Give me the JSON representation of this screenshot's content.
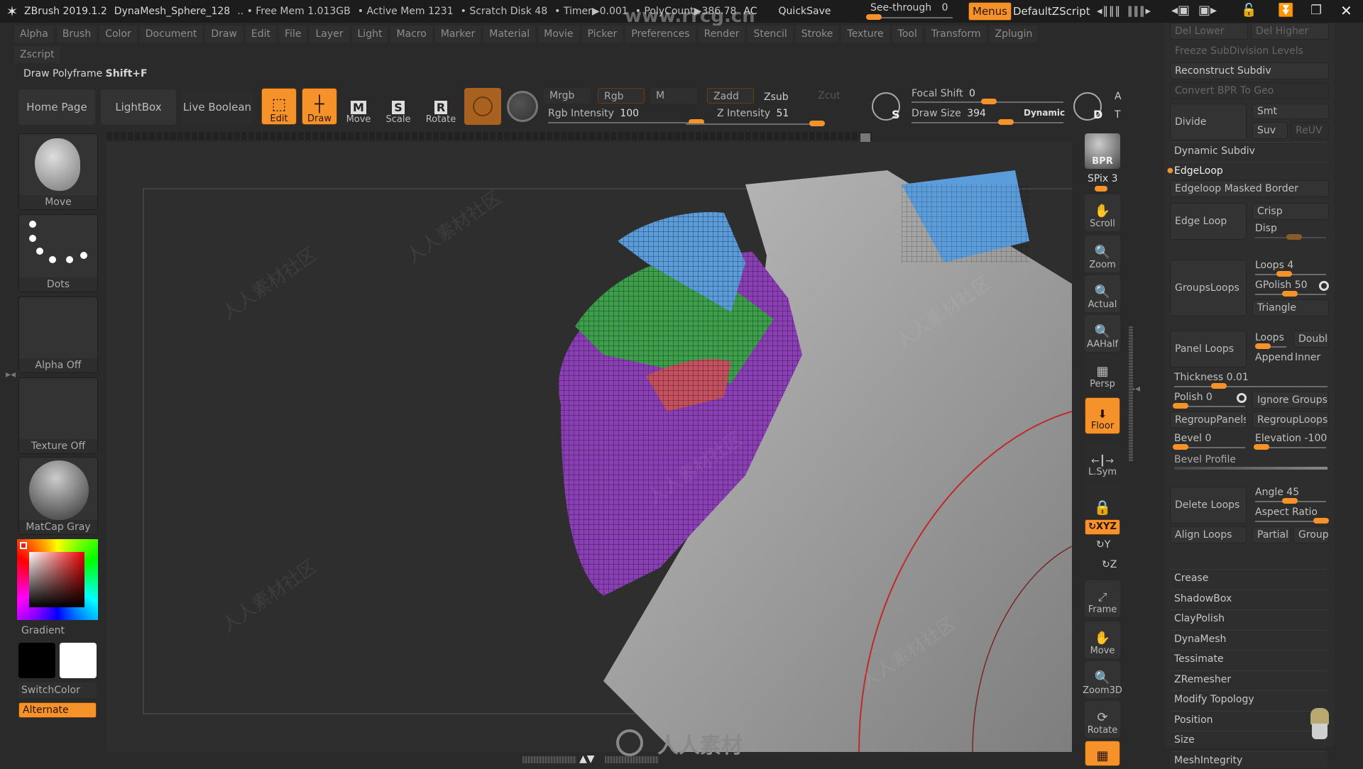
{
  "title_bar": {
    "app": "ZBrush 2019.1.2",
    "document": "DynaMesh_Sphere_128",
    "free_mem": ".. • Free Mem 1.013GB",
    "active_mem": "• Active Mem 1231",
    "scratch": "• Scratch Disk 48",
    "timer": "• Timer▶0.001",
    "polycount": "• PolyCount▶386.78",
    "ac": "AC",
    "quicksave": "QuickSave",
    "see_through_label": "See-through",
    "see_through_value": "0",
    "menus": "Menus",
    "script": "DefaultZScript",
    "watermark_url": "www.rrcg.cn"
  },
  "menus": [
    "Alpha",
    "Brush",
    "Color",
    "Document",
    "Draw",
    "Edit",
    "File",
    "Layer",
    "Light",
    "Macro",
    "Marker",
    "Material",
    "Movie",
    "Picker",
    "Preferences",
    "Render",
    "Stencil",
    "Stroke",
    "Texture",
    "Tool",
    "Transform",
    "Zplugin",
    "Zscript"
  ],
  "hint": {
    "text": "Draw Polyframe ",
    "shortcut": "Shift+F"
  },
  "toolbar": {
    "home_page": "Home Page",
    "lightbox": "LightBox",
    "live_boolean": "Live Boolean",
    "edit": "Edit",
    "draw": "Draw",
    "move": "Move",
    "scale": "Scale",
    "rotate": "Rotate",
    "mrgb": "Mrgb",
    "rgb": "Rgb",
    "m": "M",
    "zadd": "Zadd",
    "zsub": "Zsub",
    "zcut": "Zcut",
    "rgb_intensity_label": "Rgb Intensity",
    "rgb_intensity_value": "100",
    "z_intensity_label": "Z Intensity",
    "z_intensity_value": "51",
    "focal_shift_label": "Focal Shift",
    "focal_shift_value": "0",
    "draw_size_label": "Draw Size",
    "draw_size_value": "394",
    "dynamic": "Dynamic",
    "s_label": "S",
    "d_label": "D",
    "a_label": "A",
    "t_label": "T"
  },
  "left_panel": {
    "brush": "Move",
    "stroke": "Dots",
    "alpha": "Alpha Off",
    "texture": "Texture Off",
    "material": "MatCap Gray",
    "gradient": "Gradient",
    "switch_color": "SwitchColor",
    "alternate": "Alternate",
    "main_color": "#000000",
    "secondary_color": "#ffffff"
  },
  "shelf": {
    "bpr": "BPR",
    "spix_label": "SPix",
    "spix_value": "3",
    "scroll": "Scroll",
    "zoom": "Zoom",
    "actual": "Actual",
    "aahalf": "AAHalf",
    "persp": "Persp",
    "floor": "Floor",
    "lsym": "L.Sym",
    "xyz": "XYZ",
    "y": "Y",
    "z": "Z",
    "frame": "Frame",
    "move": "Move",
    "zoom3d": "Zoom3D",
    "rotate": "Rotate"
  },
  "palette": {
    "del_lower": "Del Lower",
    "del_higher": "Del Higher",
    "freeze": "Freeze SubDivision Levels",
    "reconstruct": "Reconstruct Subdiv",
    "convert_bpr": "Convert BPR To Geo",
    "divide": "Divide",
    "smt": "Smt",
    "suv": "Suv",
    "reuv": "ReUV",
    "dynamic_subdiv": "Dynamic Subdiv",
    "edgeloop": "EdgeLoop",
    "edgeloop_masked": "Edgeloop Masked Border",
    "edge_loop": "Edge Loop",
    "crisp": "Crisp",
    "disp": "Disp",
    "groups_loops": "GroupsLoops",
    "loops_label": "Loops",
    "loops_value": "4",
    "gpolish_label": "GPolish",
    "gpolish_value": "50",
    "triangle": "Triangle",
    "panel_loops": "Panel Loops",
    "panel_loops_label": "Loops",
    "double": "Double",
    "append": "Append",
    "inner": "Inner",
    "thickness_label": "Thickness",
    "thickness_value": "0.01",
    "polish_label": "Polish",
    "polish_value": "0",
    "ignore_groups": "Ignore Groups",
    "regroup_panels": "RegroupPanels",
    "regroup_loops": "RegroupLoops",
    "bevel_label": "Bevel",
    "bevel_value": "0",
    "elevation_label": "Elevation",
    "elevation_value": "-100",
    "bevel_profile": "Bevel Profile",
    "delete_loops": "Delete Loops",
    "angle_label": "Angle",
    "angle_value": "45",
    "aspect_ratio": "Aspect Ratio",
    "align_loops": "Align Loops",
    "partial": "Partial",
    "groups": "Groups",
    "sections": [
      "Crease",
      "ShadowBox",
      "ClayPolish",
      "DynaMesh",
      "Tessimate",
      "ZRemesher",
      "Modify Topology",
      "Position",
      "Size",
      "MeshIntegrity"
    ]
  },
  "watermarks": {
    "cn": "人人素材社区",
    "bottom": "人人素材"
  },
  "colors": {
    "accent": "#f5922a",
    "bg": "#2a2a2a",
    "panel": "#2e2e2e"
  }
}
